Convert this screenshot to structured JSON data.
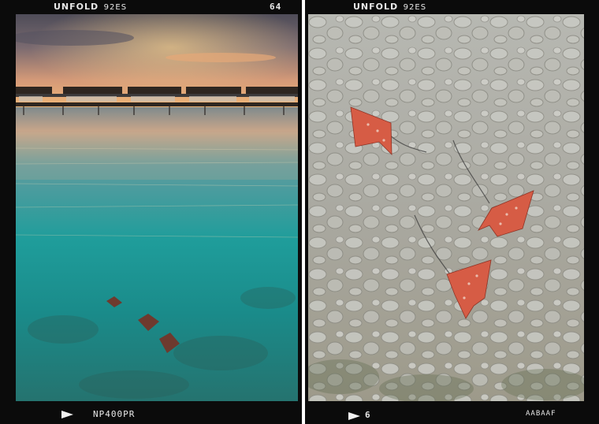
{
  "left_frame": {
    "brand": "UNFOLD",
    "brand_code": "92ES",
    "frame_number": "64",
    "film_code": "NP400PR",
    "photo_subject": "overwater-villas-sunset-eagle-rays"
  },
  "right_frame": {
    "brand": "UNFOLD",
    "brand_code": "92ES",
    "frame_number": "6",
    "film_code": "AABAAF",
    "photo_subject": "eagle-rays-over-sandy-seabed"
  },
  "colors": {
    "film_border": "#0b0b0b",
    "film_text": "#e8e8e8",
    "sky_top": "#5a5560",
    "sunset_glow": "#f0b070",
    "water_teal": "#1f9d9b",
    "ray_color": "#d65c45"
  }
}
